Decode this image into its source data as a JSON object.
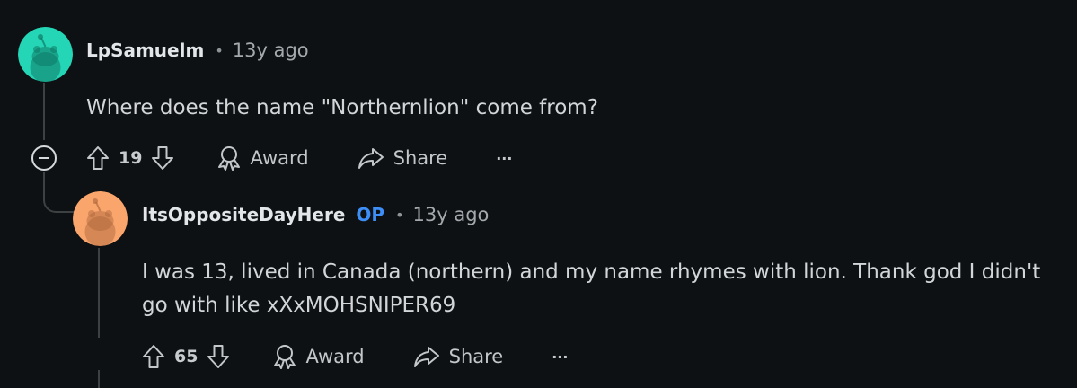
{
  "comments": [
    {
      "username": "LpSamuelm",
      "op_badge": "",
      "separator": "•",
      "time": "13y ago",
      "body": "Where does the name \"Northernlion\" come from?",
      "score": "19",
      "award_label": "Award",
      "share_label": "Share",
      "more_label": "···",
      "avatar_color": "#24d6b6"
    },
    {
      "username": "ItsOppositeDayHere",
      "op_badge": "OP",
      "separator": "•",
      "time": "13y ago",
      "body_line1": "I was 13, lived in Canada (northern) and my name rhymes with lion. Thank god I didn't",
      "body_line2": "go with like xXxMOHSNIPER69",
      "score": "65",
      "award_label": "Award",
      "share_label": "Share",
      "more_label": "···",
      "avatar_color": "#f9a56c"
    }
  ],
  "colors": {
    "background": "#0e1113",
    "op": "#3d8ef6",
    "thread_line": "#3e4142"
  }
}
